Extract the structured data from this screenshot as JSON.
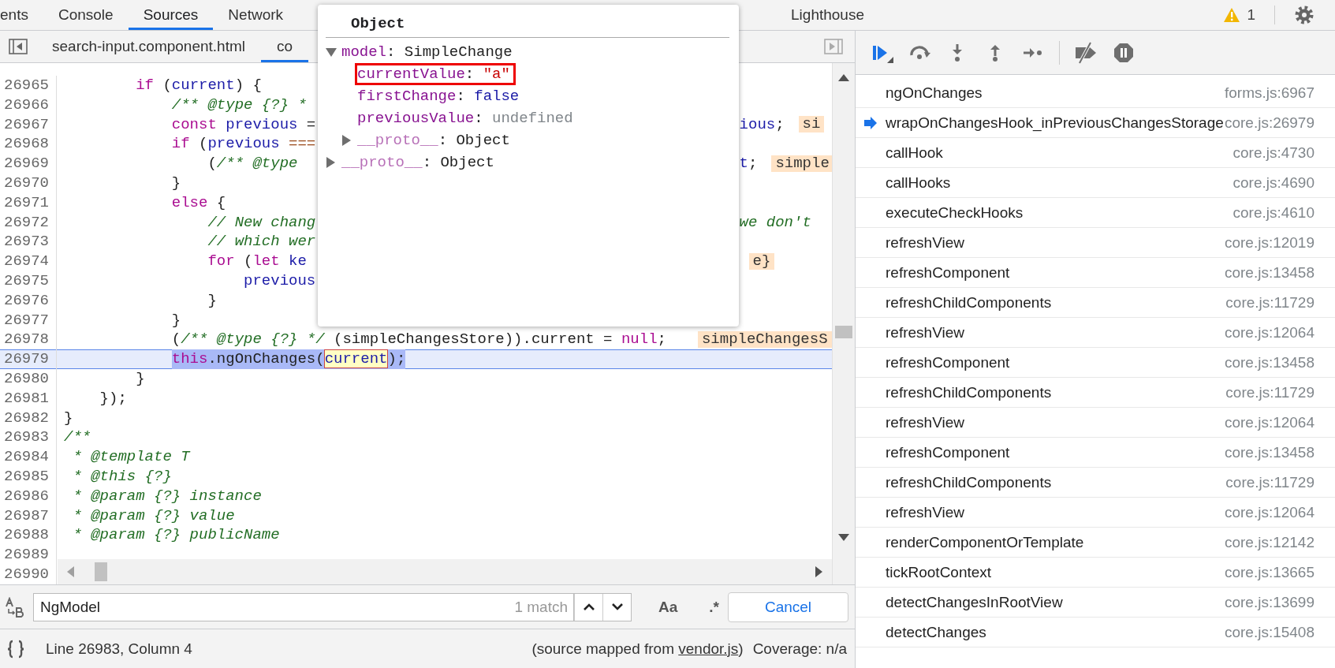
{
  "tabs": [
    {
      "label": "ents",
      "selected": false
    },
    {
      "label": "Console",
      "selected": false
    },
    {
      "label": "Sources",
      "selected": true
    },
    {
      "label": "Network",
      "selected": false
    },
    {
      "label": "Lighthouse",
      "selected": false
    }
  ],
  "warning_count": "1",
  "file_tabs": [
    {
      "label": "search-input.component.html",
      "selected": false
    },
    {
      "label": "co",
      "selected": true
    }
  ],
  "code_lines": [
    {
      "number": "26965",
      "paused": false,
      "code": [
        {
          "text": "        if",
          "kind": "keyword"
        },
        {
          "text": " (",
          "kind": "plain"
        },
        {
          "text": "current",
          "kind": "variable"
        },
        {
          "text": ") {",
          "kind": "plain"
        }
      ]
    },
    {
      "number": "26966",
      "paused": false,
      "code": [
        {
          "text": "            /** @type {?} *",
          "kind": "comment"
        }
      ]
    },
    {
      "number": "26967",
      "paused": false,
      "code": [
        {
          "text": "            const ",
          "kind": "keyword"
        },
        {
          "text": "previous",
          "kind": "variable"
        },
        {
          "text": " =",
          "kind": "plain"
        }
      ],
      "tail": [
        {
          "text": "ious",
          "kind": "variable"
        },
        {
          "text": ";",
          "kind": "plain"
        }
      ],
      "inline_value": "si"
    },
    {
      "number": "26968",
      "paused": false,
      "code": [
        {
          "text": "            if",
          "kind": "keyword"
        },
        {
          "text": " (",
          "kind": "plain"
        },
        {
          "text": "previous ",
          "kind": "variable"
        },
        {
          "text": "===",
          "kind": "operator"
        }
      ]
    },
    {
      "number": "26969",
      "paused": false,
      "code": [
        {
          "text": "                (",
          "kind": "plain"
        },
        {
          "text": "/** @type",
          "kind": "comment"
        }
      ],
      "tail": [
        {
          "text": "t",
          "kind": "variable"
        },
        {
          "text": ";",
          "kind": "plain"
        }
      ],
      "inline_value": "simple"
    },
    {
      "number": "26970",
      "paused": false,
      "code": [
        {
          "text": "            }",
          "kind": "plain"
        }
      ]
    },
    {
      "number": "26971",
      "paused": false,
      "code": [
        {
          "text": "            else",
          "kind": "keyword"
        },
        {
          "text": " {",
          "kind": "plain"
        }
      ]
    },
    {
      "number": "26972",
      "paused": false,
      "code": [
        {
          "text": "                // New chang",
          "kind": "comment"
        }
      ],
      "tail": [
        {
          "text": "we don't",
          "kind": "comment"
        }
      ]
    },
    {
      "number": "26973",
      "paused": false,
      "code": [
        {
          "text": "                // which wer",
          "kind": "comment"
        }
      ]
    },
    {
      "number": "26974",
      "paused": false,
      "code": [
        {
          "text": "                for",
          "kind": "keyword"
        },
        {
          "text": " (",
          "kind": "plain"
        },
        {
          "text": "let ",
          "kind": "keyword"
        },
        {
          "text": "ke",
          "kind": "variable"
        }
      ],
      "inline_value": "e}"
    },
    {
      "number": "26975",
      "paused": false,
      "code": [
        {
          "text": "                    previous",
          "kind": "variable"
        }
      ]
    },
    {
      "number": "26976",
      "paused": false,
      "code": [
        {
          "text": "                }",
          "kind": "plain"
        }
      ]
    },
    {
      "number": "26977",
      "paused": false,
      "code": [
        {
          "text": "            }",
          "kind": "plain"
        }
      ]
    },
    {
      "number": "26978",
      "paused": false,
      "code": [
        {
          "text": "            (",
          "kind": "plain"
        },
        {
          "text": "/** @type {?} */",
          "kind": "comment"
        },
        {
          "text": " (simpleChangesStore)).current = ",
          "kind": "plain"
        },
        {
          "text": "null",
          "kind": "keyword"
        },
        {
          "text": ";",
          "kind": "plain"
        }
      ],
      "inline_value": "simpleChangesS"
    },
    {
      "number": "26979",
      "paused": true,
      "code": [
        {
          "text": "            this",
          "kind": "keyword"
        },
        {
          "text": ".ngOnChanges(",
          "kind": "plain"
        },
        {
          "text": "current",
          "kind": "hovered"
        },
        {
          "text": ");",
          "kind": "plain"
        }
      ]
    },
    {
      "number": "26980",
      "paused": false,
      "code": [
        {
          "text": "        }",
          "kind": "plain"
        }
      ]
    },
    {
      "number": "26981",
      "paused": false,
      "code": [
        {
          "text": "    });",
          "kind": "plain"
        }
      ]
    },
    {
      "number": "26982",
      "paused": false,
      "code": [
        {
          "text": "}",
          "kind": "plain"
        }
      ]
    },
    {
      "number": "26983",
      "paused": false,
      "code": [
        {
          "text": "/**",
          "kind": "comment"
        }
      ]
    },
    {
      "number": "26984",
      "paused": false,
      "code": [
        {
          "text": " * @template T",
          "kind": "comment"
        }
      ]
    },
    {
      "number": "26985",
      "paused": false,
      "code": [
        {
          "text": " * @this {?}",
          "kind": "comment"
        }
      ]
    },
    {
      "number": "26986",
      "paused": false,
      "code": [
        {
          "text": " * @param {?} instance",
          "kind": "comment"
        }
      ]
    },
    {
      "number": "26987",
      "paused": false,
      "code": [
        {
          "text": " * @param {?} value",
          "kind": "comment"
        }
      ]
    },
    {
      "number": "26988",
      "paused": false,
      "code": [
        {
          "text": " * @param {?} publicName",
          "kind": "comment"
        }
      ]
    },
    {
      "number": "26989",
      "paused": false
    },
    {
      "number": "26990",
      "paused": false
    }
  ],
  "popover": {
    "title": "Object",
    "properties": [
      {
        "name": "model",
        "inherited": false,
        "separator": ":",
        "value": "SimpleChange",
        "kind": "object",
        "expanded": true,
        "highlighted": false,
        "children": [
          {
            "name": "currentValue",
            "inherited": false,
            "separator": ":",
            "value": "\"a\"",
            "kind": "string",
            "highlighted": true
          },
          {
            "name": "firstChange",
            "inherited": false,
            "separator": ":",
            "value": "false",
            "kind": "boolean",
            "highlighted": false
          },
          {
            "name": "previousValue",
            "inherited": false,
            "separator": ":",
            "value": "undefined",
            "kind": "undefined",
            "highlighted": false
          },
          {
            "name": "__proto__",
            "inherited": true,
            "separator": ":",
            "value": "Object",
            "kind": "object",
            "expanded": false,
            "highlighted": false
          }
        ]
      },
      {
        "name": "__proto__",
        "inherited": true,
        "separator": ":",
        "value": "Object",
        "kind": "object",
        "expanded": false,
        "highlighted": false
      }
    ]
  },
  "search": {
    "value": "NgModel",
    "match_count": "1 match",
    "case_label": "Aa",
    "regex_label": ".*",
    "cancel": "Cancel"
  },
  "status_bar": {
    "position": "Line 26983, Column 4",
    "source_before": "(source mapped from ",
    "source_link": "vendor.js",
    "source_after": ")",
    "coverage": "Coverage: n/a"
  },
  "call_stack": [
    {
      "function": "ngOnChanges",
      "location": "forms.js:6967",
      "current": false
    },
    {
      "function": "wrapOnChangesHook_inPreviousChangesStorage",
      "location": "core.js:26979",
      "current": true
    },
    {
      "function": "callHook",
      "location": "core.js:4730",
      "current": false
    },
    {
      "function": "callHooks",
      "location": "core.js:4690",
      "current": false
    },
    {
      "function": "executeCheckHooks",
      "location": "core.js:4610",
      "current": false
    },
    {
      "function": "refreshView",
      "location": "core.js:12019",
      "current": false
    },
    {
      "function": "refreshComponent",
      "location": "core.js:13458",
      "current": false
    },
    {
      "function": "refreshChildComponents",
      "location": "core.js:11729",
      "current": false
    },
    {
      "function": "refreshView",
      "location": "core.js:12064",
      "current": false
    },
    {
      "function": "refreshComponent",
      "location": "core.js:13458",
      "current": false
    },
    {
      "function": "refreshChildComponents",
      "location": "core.js:11729",
      "current": false
    },
    {
      "function": "refreshView",
      "location": "core.js:12064",
      "current": false
    },
    {
      "function": "refreshComponent",
      "location": "core.js:13458",
      "current": false
    },
    {
      "function": "refreshChildComponents",
      "location": "core.js:11729",
      "current": false
    },
    {
      "function": "refreshView",
      "location": "core.js:12064",
      "current": false
    },
    {
      "function": "renderComponentOrTemplate",
      "location": "core.js:12142",
      "current": false
    },
    {
      "function": "tickRootContext",
      "location": "core.js:13665",
      "current": false
    },
    {
      "function": "detectChangesInRootView",
      "location": "core.js:13699",
      "current": false
    },
    {
      "function": "detectChanges",
      "location": "core.js:15408",
      "current": false
    }
  ]
}
